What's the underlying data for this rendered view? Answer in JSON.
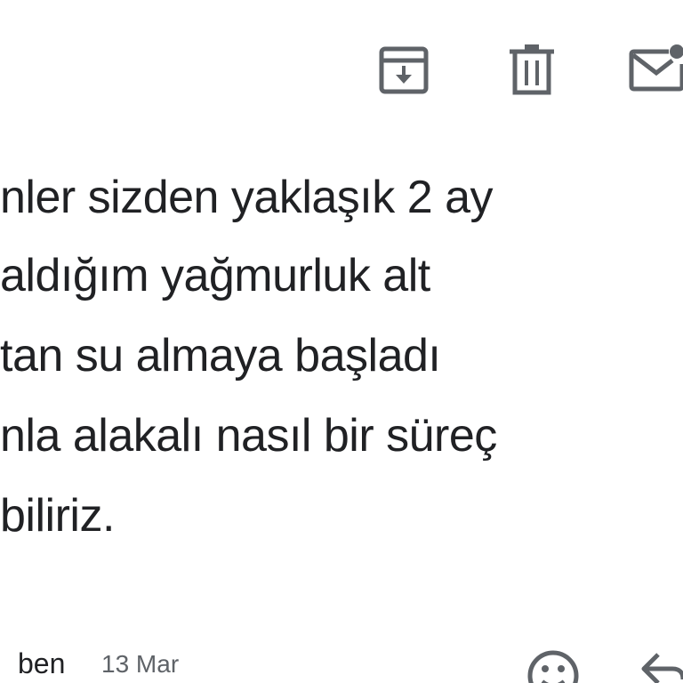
{
  "toolbar": {
    "archive_icon": "archive-icon",
    "delete_icon": "trash-icon",
    "mark_unread_icon": "mail-unread-icon"
  },
  "message": {
    "lines": [
      "nler sizden yaklaşık 2 ay",
      "aldığım yağmurluk alt",
      "tan su almaya başladı",
      "nla alakalı nasıl bir süreç",
      "biliriz."
    ]
  },
  "reply_header": {
    "sender": "ben",
    "date": "13 Mar",
    "emoji_icon": "smiley-icon",
    "reply_icon": "reply-arrow-icon"
  },
  "colors": {
    "icon": "#5f6368",
    "text": "#202124",
    "muted": "#5f6368"
  }
}
